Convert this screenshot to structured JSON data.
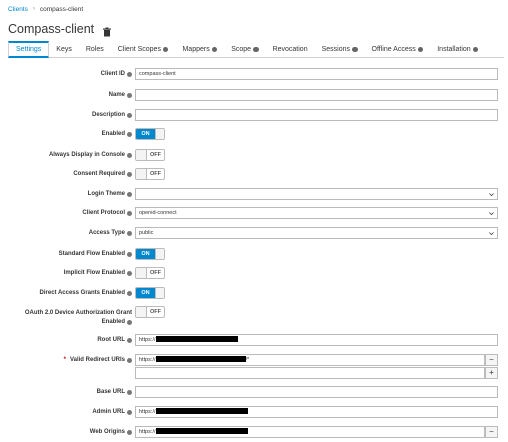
{
  "breadcrumb": {
    "parent": "Clients",
    "separator": "›",
    "current": "compass-client"
  },
  "page": {
    "title": "Compass-client"
  },
  "tabs": [
    {
      "label": "Settings",
      "help": false,
      "active": true
    },
    {
      "label": "Keys",
      "help": false
    },
    {
      "label": "Roles",
      "help": false
    },
    {
      "label": "Client Scopes",
      "help": true
    },
    {
      "label": "Mappers",
      "help": true
    },
    {
      "label": "Scope",
      "help": true
    },
    {
      "label": "Revocation",
      "help": false
    },
    {
      "label": "Sessions",
      "help": true
    },
    {
      "label": "Offline Access",
      "help": true
    },
    {
      "label": "Installation",
      "help": true
    }
  ],
  "form": {
    "client_id": {
      "label": "Client ID",
      "value": "compass-client"
    },
    "name": {
      "label": "Name",
      "value": ""
    },
    "description": {
      "label": "Description",
      "value": ""
    },
    "enabled": {
      "label": "Enabled",
      "state": "ON"
    },
    "always_display": {
      "label": "Always Display in Console",
      "state": "OFF"
    },
    "consent_required": {
      "label": "Consent Required",
      "state": "OFF"
    },
    "login_theme": {
      "label": "Login Theme",
      "value": ""
    },
    "client_protocol": {
      "label": "Client Protocol",
      "value": "openid-connect"
    },
    "access_type": {
      "label": "Access Type",
      "value": "public"
    },
    "standard_flow": {
      "label": "Standard Flow Enabled",
      "state": "ON"
    },
    "implicit_flow": {
      "label": "Implicit Flow Enabled",
      "state": "OFF"
    },
    "direct_access": {
      "label": "Direct Access Grants Enabled",
      "state": "ON"
    },
    "device_auth_line1": "OAuth 2.0 Device Authorization Grant",
    "device_auth_line2": "Enabled",
    "device_auth_state": "OFF",
    "root_url": {
      "label": "Root URL",
      "prefix": "https://"
    },
    "valid_redirect": {
      "label": "Valid Redirect URIs",
      "prefix": "https://",
      "suffix": "/*",
      "remove": "−",
      "add": "+"
    },
    "base_url": {
      "label": "Base URL",
      "value": ""
    },
    "admin_url": {
      "label": "Admin URL",
      "prefix": "https://"
    },
    "web_origins": {
      "label": "Web Origins",
      "prefix": "https://",
      "remove": "−"
    }
  },
  "colors": {
    "accent": "#0088ce",
    "required": "#cc0000"
  }
}
